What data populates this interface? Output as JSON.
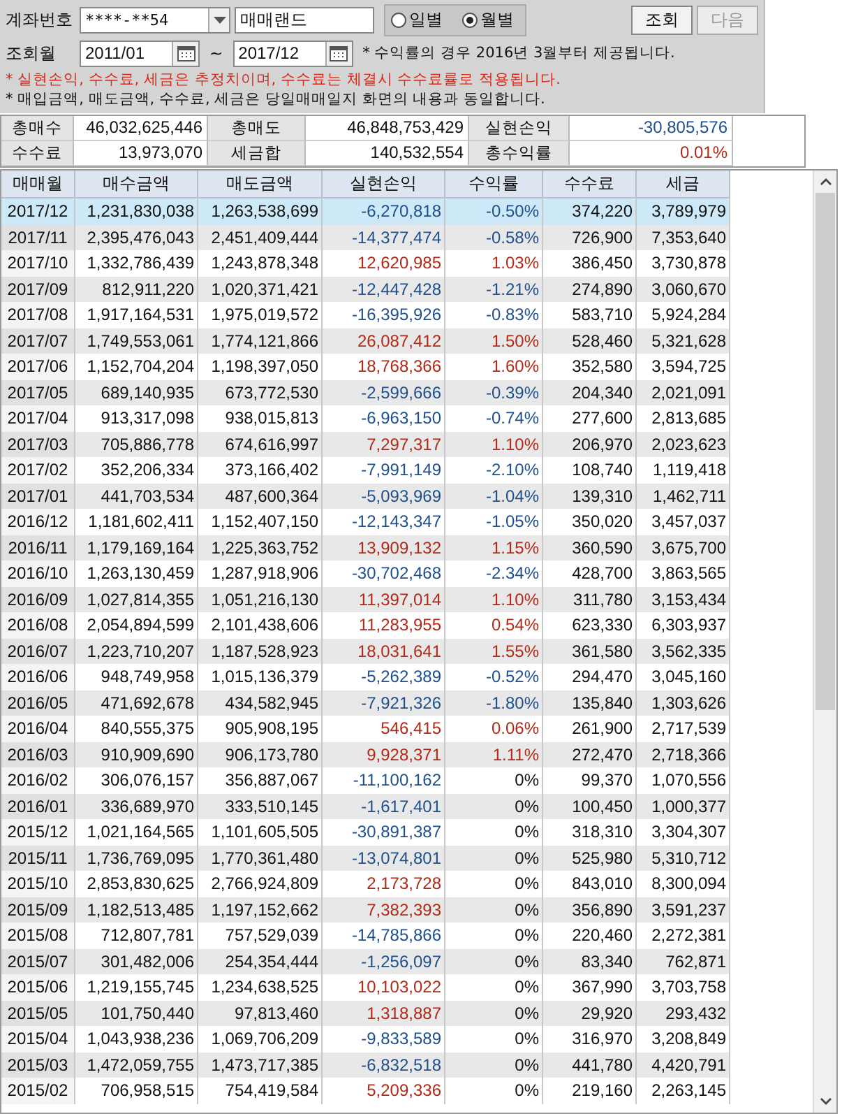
{
  "account": {
    "label": "계좌번호",
    "number": "****-**54",
    "name": "매매랜드"
  },
  "period_mode": [
    {
      "label": "일별",
      "selected": false
    },
    {
      "label": "월별",
      "selected": true
    }
  ],
  "buttons": [
    {
      "label": "조회",
      "disabled": false
    },
    {
      "label": "다음",
      "disabled": true
    }
  ],
  "date_range": {
    "label": "조회월",
    "from": "2011/01",
    "separator": "~",
    "to": "2017/12",
    "note": "* 수익률의 경우 2016년 3월부터 제공됩니다."
  },
  "notes": [
    {
      "kind": "warning",
      "text": "* 실현손익, 수수료, 세금은 추정치이며, 수수료는 체결시 수수료률로 적용됩니다."
    },
    {
      "kind": "info",
      "text": "* 매입금액, 매도금액, 수수료, 세금은 당일매매일지 화면의 내용과 동일합니다."
    }
  ],
  "summary": [
    {
      "label": "총매수",
      "value": "46,032,625,446",
      "color": "#111111"
    },
    {
      "label": "총매도",
      "value": "46,848,753,429",
      "color": "#111111"
    },
    {
      "label": "실현손익",
      "value": "-30,805,576",
      "color": "#1f4f8c"
    },
    {
      "label": "수수료",
      "value": "13,973,070",
      "color": "#111111"
    },
    {
      "label": "세금합",
      "value": "140,532,554",
      "color": "#111111"
    },
    {
      "label": "총수익률",
      "value": "0.01%",
      "color": "#b02a18"
    }
  ],
  "table": {
    "columns": [
      "매매월",
      "매수금액",
      "매도금액",
      "실현손익",
      "수익률",
      "수수료",
      "세금"
    ],
    "rows": [
      {
        "selected": true,
        "month": "2017/12",
        "buy": "1,231,830,038",
        "sell": "1,263,538,699",
        "profit": {
          "text": "-6,270,818",
          "color": "#1f4f8c"
        },
        "rate": {
          "text": "-0.50%",
          "color": "#1f4f8c"
        },
        "fee": "374,220",
        "tax": "3,789,979"
      },
      {
        "selected": false,
        "month": "2017/11",
        "buy": "2,395,476,043",
        "sell": "2,451,409,444",
        "profit": {
          "text": "-14,377,474",
          "color": "#1f4f8c"
        },
        "rate": {
          "text": "-0.58%",
          "color": "#1f4f8c"
        },
        "fee": "726,900",
        "tax": "7,353,640"
      },
      {
        "selected": false,
        "month": "2017/10",
        "buy": "1,332,786,439",
        "sell": "1,243,878,348",
        "profit": {
          "text": "12,620,985",
          "color": "#b02a18"
        },
        "rate": {
          "text": "1.03%",
          "color": "#b02a18"
        },
        "fee": "386,450",
        "tax": "3,730,878"
      },
      {
        "selected": false,
        "month": "2017/09",
        "buy": "812,911,220",
        "sell": "1,020,371,421",
        "profit": {
          "text": "-12,447,428",
          "color": "#1f4f8c"
        },
        "rate": {
          "text": "-1.21%",
          "color": "#1f4f8c"
        },
        "fee": "274,890",
        "tax": "3,060,670"
      },
      {
        "selected": false,
        "month": "2017/08",
        "buy": "1,917,164,531",
        "sell": "1,975,019,572",
        "profit": {
          "text": "-16,395,926",
          "color": "#1f4f8c"
        },
        "rate": {
          "text": "-0.83%",
          "color": "#1f4f8c"
        },
        "fee": "583,710",
        "tax": "5,924,284"
      },
      {
        "selected": false,
        "month": "2017/07",
        "buy": "1,749,553,061",
        "sell": "1,774,121,866",
        "profit": {
          "text": "26,087,412",
          "color": "#b02a18"
        },
        "rate": {
          "text": "1.50%",
          "color": "#b02a18"
        },
        "fee": "528,460",
        "tax": "5,321,628"
      },
      {
        "selected": false,
        "month": "2017/06",
        "buy": "1,152,704,204",
        "sell": "1,198,397,050",
        "profit": {
          "text": "18,768,366",
          "color": "#b02a18"
        },
        "rate": {
          "text": "1.60%",
          "color": "#b02a18"
        },
        "fee": "352,580",
        "tax": "3,594,725"
      },
      {
        "selected": false,
        "month": "2017/05",
        "buy": "689,140,935",
        "sell": "673,772,530",
        "profit": {
          "text": "-2,599,666",
          "color": "#1f4f8c"
        },
        "rate": {
          "text": "-0.39%",
          "color": "#1f4f8c"
        },
        "fee": "204,340",
        "tax": "2,021,091"
      },
      {
        "selected": false,
        "month": "2017/04",
        "buy": "913,317,098",
        "sell": "938,015,813",
        "profit": {
          "text": "-6,963,150",
          "color": "#1f4f8c"
        },
        "rate": {
          "text": "-0.74%",
          "color": "#1f4f8c"
        },
        "fee": "277,600",
        "tax": "2,813,685"
      },
      {
        "selected": false,
        "month": "2017/03",
        "buy": "705,886,778",
        "sell": "674,616,997",
        "profit": {
          "text": "7,297,317",
          "color": "#b02a18"
        },
        "rate": {
          "text": "1.10%",
          "color": "#b02a18"
        },
        "fee": "206,970",
        "tax": "2,023,623"
      },
      {
        "selected": false,
        "month": "2017/02",
        "buy": "352,206,334",
        "sell": "373,166,402",
        "profit": {
          "text": "-7,991,149",
          "color": "#1f4f8c"
        },
        "rate": {
          "text": "-2.10%",
          "color": "#1f4f8c"
        },
        "fee": "108,740",
        "tax": "1,119,418"
      },
      {
        "selected": false,
        "month": "2017/01",
        "buy": "441,703,534",
        "sell": "487,600,364",
        "profit": {
          "text": "-5,093,969",
          "color": "#1f4f8c"
        },
        "rate": {
          "text": "-1.04%",
          "color": "#1f4f8c"
        },
        "fee": "139,310",
        "tax": "1,462,711"
      },
      {
        "selected": false,
        "month": "2016/12",
        "buy": "1,181,602,411",
        "sell": "1,152,407,150",
        "profit": {
          "text": "-12,143,347",
          "color": "#1f4f8c"
        },
        "rate": {
          "text": "-1.05%",
          "color": "#1f4f8c"
        },
        "fee": "350,020",
        "tax": "3,457,037"
      },
      {
        "selected": false,
        "month": "2016/11",
        "buy": "1,179,169,164",
        "sell": "1,225,363,752",
        "profit": {
          "text": "13,909,132",
          "color": "#b02a18"
        },
        "rate": {
          "text": "1.15%",
          "color": "#b02a18"
        },
        "fee": "360,590",
        "tax": "3,675,700"
      },
      {
        "selected": false,
        "month": "2016/10",
        "buy": "1,263,130,459",
        "sell": "1,287,918,906",
        "profit": {
          "text": "-30,702,468",
          "color": "#1f4f8c"
        },
        "rate": {
          "text": "-2.34%",
          "color": "#1f4f8c"
        },
        "fee": "428,700",
        "tax": "3,863,565"
      },
      {
        "selected": false,
        "month": "2016/09",
        "buy": "1,027,814,355",
        "sell": "1,051,216,130",
        "profit": {
          "text": "11,397,014",
          "color": "#b02a18"
        },
        "rate": {
          "text": "1.10%",
          "color": "#b02a18"
        },
        "fee": "311,780",
        "tax": "3,153,434"
      },
      {
        "selected": false,
        "month": "2016/08",
        "buy": "2,054,894,599",
        "sell": "2,101,438,606",
        "profit": {
          "text": "11,283,955",
          "color": "#b02a18"
        },
        "rate": {
          "text": "0.54%",
          "color": "#b02a18"
        },
        "fee": "623,330",
        "tax": "6,303,937"
      },
      {
        "selected": false,
        "month": "2016/07",
        "buy": "1,223,710,207",
        "sell": "1,187,528,923",
        "profit": {
          "text": "18,031,641",
          "color": "#b02a18"
        },
        "rate": {
          "text": "1.55%",
          "color": "#b02a18"
        },
        "fee": "361,580",
        "tax": "3,562,335"
      },
      {
        "selected": false,
        "month": "2016/06",
        "buy": "948,749,958",
        "sell": "1,015,136,379",
        "profit": {
          "text": "-5,262,389",
          "color": "#1f4f8c"
        },
        "rate": {
          "text": "-0.52%",
          "color": "#1f4f8c"
        },
        "fee": "294,470",
        "tax": "3,045,160"
      },
      {
        "selected": false,
        "month": "2016/05",
        "buy": "471,692,678",
        "sell": "434,582,945",
        "profit": {
          "text": "-7,921,326",
          "color": "#1f4f8c"
        },
        "rate": {
          "text": "-1.80%",
          "color": "#1f4f8c"
        },
        "fee": "135,840",
        "tax": "1,303,626"
      },
      {
        "selected": false,
        "month": "2016/04",
        "buy": "840,555,375",
        "sell": "905,908,195",
        "profit": {
          "text": "546,415",
          "color": "#b02a18"
        },
        "rate": {
          "text": "0.06%",
          "color": "#b02a18"
        },
        "fee": "261,900",
        "tax": "2,717,539"
      },
      {
        "selected": false,
        "month": "2016/03",
        "buy": "910,909,690",
        "sell": "906,173,780",
        "profit": {
          "text": "9,928,371",
          "color": "#b02a18"
        },
        "rate": {
          "text": "1.11%",
          "color": "#b02a18"
        },
        "fee": "272,470",
        "tax": "2,718,366"
      },
      {
        "selected": false,
        "month": "2016/02",
        "buy": "306,076,157",
        "sell": "356,887,067",
        "profit": {
          "text": "-11,100,162",
          "color": "#1f4f8c"
        },
        "rate": {
          "text": "0%",
          "color": "#111111"
        },
        "fee": "99,370",
        "tax": "1,070,556"
      },
      {
        "selected": false,
        "month": "2016/01",
        "buy": "336,689,970",
        "sell": "333,510,145",
        "profit": {
          "text": "-1,617,401",
          "color": "#1f4f8c"
        },
        "rate": {
          "text": "0%",
          "color": "#111111"
        },
        "fee": "100,450",
        "tax": "1,000,377"
      },
      {
        "selected": false,
        "month": "2015/12",
        "buy": "1,021,164,565",
        "sell": "1,101,605,505",
        "profit": {
          "text": "-30,891,387",
          "color": "#1f4f8c"
        },
        "rate": {
          "text": "0%",
          "color": "#111111"
        },
        "fee": "318,310",
        "tax": "3,304,307"
      },
      {
        "selected": false,
        "month": "2015/11",
        "buy": "1,736,769,095",
        "sell": "1,770,361,480",
        "profit": {
          "text": "-13,074,801",
          "color": "#1f4f8c"
        },
        "rate": {
          "text": "0%",
          "color": "#111111"
        },
        "fee": "525,980",
        "tax": "5,310,712"
      },
      {
        "selected": false,
        "month": "2015/10",
        "buy": "2,853,830,625",
        "sell": "2,766,924,809",
        "profit": {
          "text": "2,173,728",
          "color": "#b02a18"
        },
        "rate": {
          "text": "0%",
          "color": "#111111"
        },
        "fee": "843,010",
        "tax": "8,300,094"
      },
      {
        "selected": false,
        "month": "2015/09",
        "buy": "1,182,513,485",
        "sell": "1,197,152,662",
        "profit": {
          "text": "7,382,393",
          "color": "#b02a18"
        },
        "rate": {
          "text": "0%",
          "color": "#111111"
        },
        "fee": "356,890",
        "tax": "3,591,237"
      },
      {
        "selected": false,
        "month": "2015/08",
        "buy": "712,807,781",
        "sell": "757,529,039",
        "profit": {
          "text": "-14,785,866",
          "color": "#1f4f8c"
        },
        "rate": {
          "text": "0%",
          "color": "#111111"
        },
        "fee": "220,460",
        "tax": "2,272,381"
      },
      {
        "selected": false,
        "month": "2015/07",
        "buy": "301,482,006",
        "sell": "254,354,444",
        "profit": {
          "text": "-1,256,097",
          "color": "#1f4f8c"
        },
        "rate": {
          "text": "0%",
          "color": "#111111"
        },
        "fee": "83,340",
        "tax": "762,871"
      },
      {
        "selected": false,
        "month": "2015/06",
        "buy": "1,219,155,745",
        "sell": "1,234,638,525",
        "profit": {
          "text": "10,103,022",
          "color": "#b02a18"
        },
        "rate": {
          "text": "0%",
          "color": "#111111"
        },
        "fee": "367,990",
        "tax": "3,703,758"
      },
      {
        "selected": false,
        "month": "2015/05",
        "buy": "101,750,440",
        "sell": "97,813,460",
        "profit": {
          "text": "1,318,887",
          "color": "#b02a18"
        },
        "rate": {
          "text": "0%",
          "color": "#111111"
        },
        "fee": "29,920",
        "tax": "293,432"
      },
      {
        "selected": false,
        "month": "2015/04",
        "buy": "1,043,938,236",
        "sell": "1,069,706,209",
        "profit": {
          "text": "-9,833,589",
          "color": "#1f4f8c"
        },
        "rate": {
          "text": "0%",
          "color": "#111111"
        },
        "fee": "316,970",
        "tax": "3,208,849"
      },
      {
        "selected": false,
        "month": "2015/03",
        "buy": "1,472,059,755",
        "sell": "1,473,717,385",
        "profit": {
          "text": "-6,832,518",
          "color": "#1f4f8c"
        },
        "rate": {
          "text": "0%",
          "color": "#111111"
        },
        "fee": "441,780",
        "tax": "4,420,791"
      },
      {
        "selected": false,
        "month": "2015/02",
        "buy": "706,958,515",
        "sell": "754,419,584",
        "profit": {
          "text": "5,209,336",
          "color": "#b02a18"
        },
        "rate": {
          "text": "0%",
          "color": "#111111"
        },
        "fee": "219,160",
        "tax": "2,263,145"
      }
    ]
  }
}
